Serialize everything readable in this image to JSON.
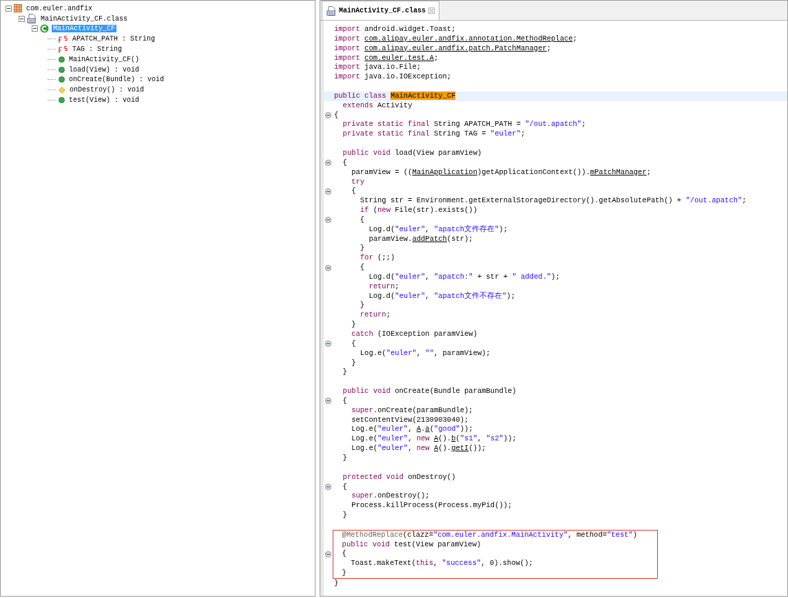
{
  "package_tree": {
    "items": [
      {
        "label": "com.euler.andfix",
        "kind": "package",
        "selected": false,
        "expanded": true,
        "children": [
          {
            "label": "MainActivity_CF.class",
            "kind": "classfile",
            "selected": false,
            "expanded": true,
            "children": [
              {
                "label": "MainActivity_CF",
                "kind": "class",
                "selected": true,
                "expanded": true,
                "children": [
                  {
                    "label": "APATCH_PATH : String",
                    "kind": "static-field",
                    "selected": false
                  },
                  {
                    "label": "TAG : String",
                    "kind": "static-field",
                    "selected": false
                  },
                  {
                    "label": "MainActivity_CF()",
                    "kind": "public-method",
                    "selected": false
                  },
                  {
                    "label": "load(View) : void",
                    "kind": "public-method",
                    "selected": false
                  },
                  {
                    "label": "onCreate(Bundle) : void",
                    "kind": "public-method",
                    "selected": false
                  },
                  {
                    "label": "onDestroy() : void",
                    "kind": "protected-method",
                    "selected": false
                  },
                  {
                    "label": "test(View) : void",
                    "kind": "public-method",
                    "selected": false
                  }
                ]
              }
            ]
          }
        ]
      }
    ]
  },
  "editor": {
    "tabs": [
      {
        "label": "MainActivity_CF.class",
        "selected": true
      }
    ],
    "blocks": [
      {
        "boxed": false,
        "lines": [
          {
            "fold": false,
            "current": false,
            "parts": [
              {
                "kind": "kw",
                "text": "import"
              },
              {
                "kind": "plain",
                "text": " android.widget.Toast;"
              }
            ]
          },
          {
            "fold": false,
            "current": false,
            "parts": [
              {
                "kind": "kw",
                "text": "import "
              },
              {
                "kind": "link",
                "text": "com.alipay.euler.andfix.annotation.MethodReplace"
              },
              {
                "kind": "plain",
                "text": ";"
              }
            ]
          },
          {
            "fold": false,
            "current": false,
            "parts": [
              {
                "kind": "kw",
                "text": "import "
              },
              {
                "kind": "link",
                "text": "com.alipay.euler.andfix.patch.PatchManager"
              },
              {
                "kind": "plain",
                "text": ";"
              }
            ]
          },
          {
            "fold": false,
            "current": false,
            "parts": [
              {
                "kind": "kw",
                "text": "import "
              },
              {
                "kind": "link",
                "text": "com.euler.test.A"
              },
              {
                "kind": "plain",
                "text": ";"
              }
            ]
          },
          {
            "fold": false,
            "current": false,
            "parts": [
              {
                "kind": "kw",
                "text": "import"
              },
              {
                "kind": "plain",
                "text": " java.io.File;"
              }
            ]
          },
          {
            "fold": false,
            "current": false,
            "parts": [
              {
                "kind": "kw",
                "text": "import"
              },
              {
                "kind": "plain",
                "text": " java.io.IOException;"
              }
            ]
          },
          {
            "fold": false,
            "current": false
          },
          {
            "fold": false,
            "current": true,
            "parts": [
              {
                "kind": "kw",
                "text": "public class "
              },
              {
                "kind": "hl",
                "text": "MainActivity_CF"
              }
            ]
          },
          {
            "fold": false,
            "current": false,
            "parts": [
              {
                "kind": "kw",
                "text": "  extends"
              },
              {
                "kind": "plain",
                "text": " Activity"
              }
            ]
          },
          {
            "fold": true,
            "current": false,
            "parts": [
              {
                "kind": "plain",
                "text": "{"
              }
            ]
          },
          {
            "fold": false,
            "current": false,
            "parts": [
              {
                "kind": "kw",
                "text": "  private static final"
              },
              {
                "kind": "plain",
                "text": " String APATCH_PATH = "
              },
              {
                "kind": "str",
                "text": "\"/out.apatch\""
              },
              {
                "kind": "plain",
                "text": ";"
              }
            ]
          },
          {
            "fold": false,
            "current": false,
            "parts": [
              {
                "kind": "kw",
                "text": "  private static final"
              },
              {
                "kind": "plain",
                "text": " String TAG = "
              },
              {
                "kind": "str",
                "text": "\"euler\""
              },
              {
                "kind": "plain",
                "text": ";"
              }
            ]
          },
          {
            "fold": false,
            "current": false
          },
          {
            "fold": false,
            "current": false,
            "parts": [
              {
                "kind": "kw",
                "text": "  public void"
              },
              {
                "kind": "plain",
                "text": " load(View paramView)"
              }
            ]
          },
          {
            "fold": true,
            "current": false,
            "parts": [
              {
                "kind": "plain",
                "text": "  {"
              }
            ]
          },
          {
            "fold": false,
            "current": false,
            "parts": [
              {
                "kind": "plain",
                "text": "    paramView = (("
              },
              {
                "kind": "link",
                "text": "MainApplication"
              },
              {
                "kind": "plain",
                "text": ")getApplicationContext())."
              },
              {
                "kind": "link",
                "text": "mPatchManager"
              },
              {
                "kind": "plain",
                "text": ";"
              }
            ]
          },
          {
            "fold": false,
            "current": false,
            "parts": [
              {
                "kind": "kw",
                "text": "    try"
              }
            ]
          },
          {
            "fold": true,
            "current": false,
            "parts": [
              {
                "kind": "plain",
                "text": "    {"
              }
            ]
          },
          {
            "fold": false,
            "current": false,
            "parts": [
              {
                "kind": "plain",
                "text": "      String str = Environment.getExternalStorageDirectory().getAbsolutePath() + "
              },
              {
                "kind": "str",
                "text": "\"/out.apatch\""
              },
              {
                "kind": "plain",
                "text": ";"
              }
            ]
          },
          {
            "fold": false,
            "current": false,
            "parts": [
              {
                "kind": "kw",
                "text": "      if"
              },
              {
                "kind": "plain",
                "text": " ("
              },
              {
                "kind": "kw",
                "text": "new"
              },
              {
                "kind": "plain",
                "text": " File(str).exists())"
              }
            ]
          },
          {
            "fold": true,
            "current": false,
            "parts": [
              {
                "kind": "plain",
                "text": "      {"
              }
            ]
          },
          {
            "fold": false,
            "current": false,
            "parts": [
              {
                "kind": "plain",
                "text": "        Log.d("
              },
              {
                "kind": "str",
                "text": "\"euler\""
              },
              {
                "kind": "plain",
                "text": ", "
              },
              {
                "kind": "str",
                "text": "\"apatch文件存在\""
              },
              {
                "kind": "plain",
                "text": ");"
              }
            ]
          },
          {
            "fold": false,
            "current": false,
            "parts": [
              {
                "kind": "plain",
                "text": "        paramView."
              },
              {
                "kind": "link",
                "text": "addPatch"
              },
              {
                "kind": "plain",
                "text": "(str);"
              }
            ]
          },
          {
            "fold": false,
            "current": false,
            "parts": [
              {
                "kind": "plain",
                "text": "      }"
              }
            ]
          },
          {
            "fold": false,
            "current": false,
            "parts": [
              {
                "kind": "kw",
                "text": "      for"
              },
              {
                "kind": "plain",
                "text": " (;;)"
              }
            ]
          },
          {
            "fold": true,
            "current": false,
            "parts": [
              {
                "kind": "plain",
                "text": "      {"
              }
            ]
          },
          {
            "fold": false,
            "current": false,
            "parts": [
              {
                "kind": "plain",
                "text": "        Log.d("
              },
              {
                "kind": "str",
                "text": "\"euler\""
              },
              {
                "kind": "plain",
                "text": ", "
              },
              {
                "kind": "str",
                "text": "\"apatch:\""
              },
              {
                "kind": "plain",
                "text": " + str + "
              },
              {
                "kind": "str",
                "text": "\" added.\""
              },
              {
                "kind": "plain",
                "text": ");"
              }
            ]
          },
          {
            "fold": false,
            "current": false,
            "parts": [
              {
                "kind": "kw",
                "text": "        return"
              },
              {
                "kind": "plain",
                "text": ";"
              }
            ]
          },
          {
            "fold": false,
            "current": false,
            "parts": [
              {
                "kind": "plain",
                "text": "        Log.d("
              },
              {
                "kind": "str",
                "text": "\"euler\""
              },
              {
                "kind": "plain",
                "text": ", "
              },
              {
                "kind": "str",
                "text": "\"apatch文件不存在\""
              },
              {
                "kind": "plain",
                "text": ");"
              }
            ]
          },
          {
            "fold": false,
            "current": false,
            "parts": [
              {
                "kind": "plain",
                "text": "      }"
              }
            ]
          },
          {
            "fold": false,
            "current": false,
            "parts": [
              {
                "kind": "kw",
                "text": "      return"
              },
              {
                "kind": "plain",
                "text": ";"
              }
            ]
          },
          {
            "fold": false,
            "current": false,
            "parts": [
              {
                "kind": "plain",
                "text": "    }"
              }
            ]
          },
          {
            "fold": false,
            "current": false,
            "parts": [
              {
                "kind": "kw",
                "text": "    catch"
              },
              {
                "kind": "plain",
                "text": " (IOException paramView)"
              }
            ]
          },
          {
            "fold": true,
            "current": false,
            "parts": [
              {
                "kind": "plain",
                "text": "    {"
              }
            ]
          },
          {
            "fold": false,
            "current": false,
            "parts": [
              {
                "kind": "plain",
                "text": "      Log.e("
              },
              {
                "kind": "str",
                "text": "\"euler\""
              },
              {
                "kind": "plain",
                "text": ", "
              },
              {
                "kind": "str",
                "text": "\"\""
              },
              {
                "kind": "plain",
                "text": ", paramView);"
              }
            ]
          },
          {
            "fold": false,
            "current": false,
            "parts": [
              {
                "kind": "plain",
                "text": "    }"
              }
            ]
          },
          {
            "fold": false,
            "current": false,
            "parts": [
              {
                "kind": "plain",
                "text": "  }"
              }
            ]
          },
          {
            "fold": false,
            "current": false
          },
          {
            "fold": false,
            "current": false,
            "parts": [
              {
                "kind": "kw",
                "text": "  public void"
              },
              {
                "kind": "plain",
                "text": " onCreate(Bundle paramBundle)"
              }
            ]
          },
          {
            "fold": true,
            "current": false,
            "parts": [
              {
                "kind": "plain",
                "text": "  {"
              }
            ]
          },
          {
            "fold": false,
            "current": false,
            "parts": [
              {
                "kind": "kw",
                "text": "    super"
              },
              {
                "kind": "plain",
                "text": ".onCreate(paramBundle);"
              }
            ]
          },
          {
            "fold": false,
            "current": false,
            "parts": [
              {
                "kind": "plain",
                "text": "    setContentView(2130903040);"
              }
            ]
          },
          {
            "fold": false,
            "current": false,
            "parts": [
              {
                "kind": "plain",
                "text": "    Log.e("
              },
              {
                "kind": "str",
                "text": "\"euler\""
              },
              {
                "kind": "plain",
                "text": ", "
              },
              {
                "kind": "link",
                "text": "A"
              },
              {
                "kind": "plain",
                "text": "."
              },
              {
                "kind": "link",
                "text": "a"
              },
              {
                "kind": "plain",
                "text": "("
              },
              {
                "kind": "str",
                "text": "\"good\""
              },
              {
                "kind": "plain",
                "text": "));"
              }
            ]
          },
          {
            "fold": false,
            "current": false,
            "parts": [
              {
                "kind": "plain",
                "text": "    Log.e("
              },
              {
                "kind": "str",
                "text": "\"euler\""
              },
              {
                "kind": "plain",
                "text": ", "
              },
              {
                "kind": "kw",
                "text": "new "
              },
              {
                "kind": "link",
                "text": "A"
              },
              {
                "kind": "plain",
                "text": "()."
              },
              {
                "kind": "link",
                "text": "b"
              },
              {
                "kind": "plain",
                "text": "("
              },
              {
                "kind": "str",
                "text": "\"s1\""
              },
              {
                "kind": "plain",
                "text": ", "
              },
              {
                "kind": "str",
                "text": "\"s2\""
              },
              {
                "kind": "plain",
                "text": "));"
              }
            ]
          },
          {
            "fold": false,
            "current": false,
            "parts": [
              {
                "kind": "plain",
                "text": "    Log.e("
              },
              {
                "kind": "str",
                "text": "\"euler\""
              },
              {
                "kind": "plain",
                "text": ", "
              },
              {
                "kind": "kw",
                "text": "new "
              },
              {
                "kind": "link",
                "text": "A"
              },
              {
                "kind": "plain",
                "text": "()."
              },
              {
                "kind": "link",
                "text": "getI"
              },
              {
                "kind": "plain",
                "text": "());"
              }
            ]
          },
          {
            "fold": false,
            "current": false,
            "parts": [
              {
                "kind": "plain",
                "text": "  }"
              }
            ]
          },
          {
            "fold": false,
            "current": false
          },
          {
            "fold": false,
            "current": false,
            "parts": [
              {
                "kind": "kw",
                "text": "  protected void"
              },
              {
                "kind": "plain",
                "text": " onDestroy()"
              }
            ]
          },
          {
            "fold": true,
            "current": false,
            "parts": [
              {
                "kind": "plain",
                "text": "  {"
              }
            ]
          },
          {
            "fold": false,
            "current": false,
            "parts": [
              {
                "kind": "kw",
                "text": "    super"
              },
              {
                "kind": "plain",
                "text": ".onDestroy();"
              }
            ]
          },
          {
            "fold": false,
            "current": false,
            "parts": [
              {
                "kind": "plain",
                "text": "    Process.killProcess(Process.myPid());"
              }
            ]
          },
          {
            "fold": false,
            "current": false,
            "parts": [
              {
                "kind": "plain",
                "text": "  }"
              }
            ]
          },
          {
            "fold": false,
            "current": false
          }
        ]
      },
      {
        "boxed": true,
        "lines": [
          {
            "fold": false,
            "current": false,
            "parts": [
              {
                "kind": "ann",
                "text": "  @MethodReplace"
              },
              {
                "kind": "plain",
                "text": "(clazz="
              },
              {
                "kind": "str",
                "text": "\"com.euler.andfix.MainActivity\""
              },
              {
                "kind": "plain",
                "text": ", method="
              },
              {
                "kind": "str",
                "text": "\"test\""
              },
              {
                "kind": "plain",
                "text": ")"
              }
            ]
          },
          {
            "fold": false,
            "current": false,
            "parts": [
              {
                "kind": "kw",
                "text": "  public void"
              },
              {
                "kind": "plain",
                "text": " test(View paramView)"
              }
            ]
          },
          {
            "fold": true,
            "current": false,
            "parts": [
              {
                "kind": "plain",
                "text": "  {"
              }
            ]
          },
          {
            "fold": false,
            "current": false,
            "parts": [
              {
                "kind": "plain",
                "text": "    Toast.makeText("
              },
              {
                "kind": "kw",
                "text": "this"
              },
              {
                "kind": "plain",
                "text": ", "
              },
              {
                "kind": "str",
                "text": "\"success\""
              },
              {
                "kind": "plain",
                "text": ", 0).show();"
              }
            ]
          },
          {
            "fold": false,
            "current": false,
            "parts": [
              {
                "kind": "plain",
                "text": "  }"
              }
            ]
          }
        ]
      },
      {
        "boxed": false,
        "lines": [
          {
            "fold": false,
            "current": false,
            "parts": [
              {
                "kind": "plain",
                "text": "}"
              }
            ]
          }
        ]
      }
    ]
  }
}
